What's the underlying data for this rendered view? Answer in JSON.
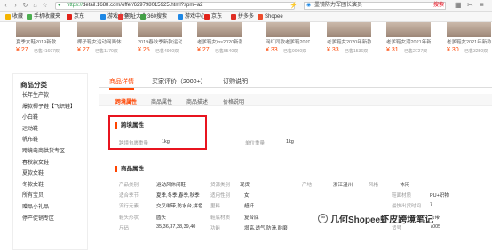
{
  "browser": {
    "url_prefix": "https://",
    "url_rest": "detail.1688.com/offer/629798015925.html?spm=a2",
    "search_text": "墨镜防力军团长演员",
    "search_button": "搜索"
  },
  "bookmarks": [
    {
      "label": "收藏",
      "color": "#f4b400"
    },
    {
      "label": "手机收藏夹",
      "color": "#4caf50"
    },
    {
      "label": "京东",
      "color": "#e2231a"
    },
    {
      "label": "游戏大全",
      "color": "#1e88e5"
    },
    {
      "label": "网址大全",
      "color": "#e53935"
    },
    {
      "label": "360搜索",
      "color": "#43a047"
    },
    {
      "label": "游戏中心",
      "color": "#1e88e5"
    },
    {
      "label": "京东",
      "color": "#e2231a"
    },
    {
      "label": "拼多多",
      "color": "#e02e24"
    },
    {
      "label": "Shopee",
      "color": "#ee4d2d"
    }
  ],
  "products": [
    {
      "name": "夏季女鞋2019新款",
      "price": "¥ 27",
      "sold": "已售41697双"
    },
    {
      "name": "椰子鞋女运动网面休闲",
      "price": "¥ 27",
      "sold": "已售1170双"
    },
    {
      "name": "2019春秋季新款运动",
      "price": "¥ 25",
      "sold": "已售4960双"
    },
    {
      "name": "老爹鞋女ins2020新款",
      "price": "¥ 27",
      "sold": "已售5540双"
    },
    {
      "name": "网红同款老爹鞋2020",
      "price": "¥ 33",
      "sold": "已售9090双"
    },
    {
      "name": "老爹鞋女2020年新款ins",
      "price": "¥ 33",
      "sold": "已售1536双"
    },
    {
      "name": "老爹鞋女潮2021年新款",
      "price": "¥ 31",
      "sold": "已售2727双"
    },
    {
      "name": "老爹鞋女2021年新款ins",
      "price": "¥ 30",
      "sold": "已售3250双"
    }
  ],
  "sidebar": {
    "title": "商品分类",
    "items": [
      "长年生产款",
      "爆款椰子鞋【飞织鞋】",
      "小白鞋",
      "运动鞋",
      "帆布鞋",
      "跨境电商供货专区",
      "春秋款女鞋",
      "夏款女鞋",
      "冬款女鞋",
      "所有宝贝",
      "赠品小礼品",
      "停产促销专区"
    ]
  },
  "tabs": [
    "商品详情",
    "买家评价（2000+）",
    "订购说明"
  ],
  "subtabs": [
    "跨境属性",
    "商品属性",
    "商品描述",
    "价格说明"
  ],
  "cross_border": {
    "heading": "跨境属性",
    "weight_label": "跨境包裹重量",
    "weight_value": "1kg",
    "unit_weight_label": "单位重量",
    "unit_weight_value": "1kg"
  },
  "attributes": {
    "heading": "商品属性",
    "rows": [
      [
        {
          "k": "产品类别",
          "v": "运动风休闲鞋"
        },
        {
          "k": "货源类别",
          "v": "现货"
        },
        {
          "k": "产地",
          "v": "浙江温州"
        },
        {
          "k": "风格",
          "v": "休闲"
        }
      ],
      [
        {
          "k": "适合季节",
          "v": "夏季,冬季,春季,秋季"
        },
        {
          "k": "适用性别",
          "v": "女"
        },
        {
          "k": "鞋面材质",
          "v": "PU+织物"
        }
      ],
      [
        {
          "k": "流行元素",
          "v": "交叉绑带,防水台,拼色"
        },
        {
          "k": "里料",
          "v": "超纤"
        },
        {
          "k": "最快出货时间",
          "v": "7"
        }
      ],
      [
        {
          "k": "鞋头形状",
          "v": "圆头"
        },
        {
          "k": "鞋底材质",
          "v": "复合底"
        },
        {
          "k": "闭合方式",
          "v": "系带"
        }
      ],
      [
        {
          "k": "尺码",
          "v": "35,36,37,38,39,40"
        },
        {
          "k": "功能",
          "v": "增高,透气,防滑,耐磨"
        },
        {
          "k": "货号",
          "v": "7005"
        }
      ]
    ]
  },
  "watermark": "几何Shopee虾皮跨境笔记"
}
